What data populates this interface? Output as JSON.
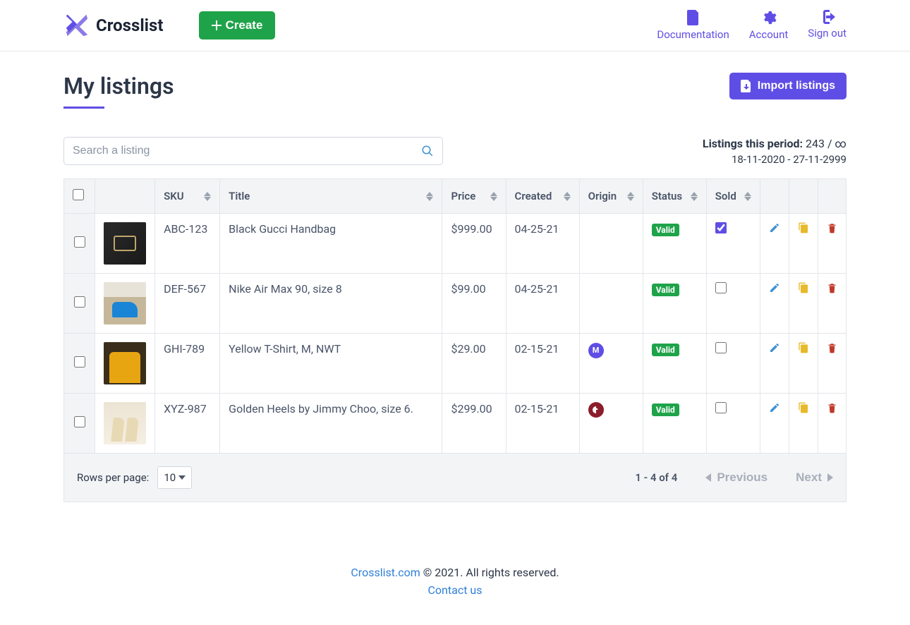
{
  "brand": {
    "name": "Crosslist"
  },
  "topnav": {
    "create_label": "Create",
    "items": [
      {
        "label": "Documentation"
      },
      {
        "label": "Account"
      },
      {
        "label": "Sign out"
      }
    ]
  },
  "page": {
    "title": "My listings",
    "import_label": "Import listings",
    "search_placeholder": "Search a listing",
    "stats_label": "Listings this period:",
    "stats_value": "243 / ∞",
    "stats_period": "18-11-2020 - 27-11-2999"
  },
  "table": {
    "headers": {
      "sku": "SKU",
      "title": "Title",
      "price": "Price",
      "created": "Created",
      "origin": "Origin",
      "status": "Status",
      "sold": "Sold"
    },
    "rows": [
      {
        "sku": "ABC-123",
        "title": "Black Gucci Handbag",
        "price": "$999.00",
        "created": "04-25-21",
        "origin": "",
        "status": "Valid",
        "sold": true,
        "thumb": "bag"
      },
      {
        "sku": "DEF-567",
        "title": "Nike Air Max 90, size 8",
        "price": "$99.00",
        "created": "04-25-21",
        "origin": "",
        "status": "Valid",
        "sold": false,
        "thumb": "shoe"
      },
      {
        "sku": "GHI-789",
        "title": "Yellow T-Shirt, M, NWT",
        "price": "$29.00",
        "created": "02-15-21",
        "origin": "mercari",
        "status": "Valid",
        "sold": false,
        "thumb": "shirt"
      },
      {
        "sku": "XYZ-987",
        "title": "Golden Heels by Jimmy Choo, size 6.",
        "price": "$299.00",
        "created": "02-15-21",
        "origin": "poshmark",
        "status": "Valid",
        "sold": false,
        "thumb": "heels"
      }
    ]
  },
  "pagination": {
    "rows_per_page_label": "Rows per page:",
    "rows_per_page_value": "10",
    "range": "1 - 4 of 4",
    "prev_label": "Previous",
    "next_label": "Next"
  },
  "footer": {
    "site": "Crosslist.com",
    "rights": "© 2021. All rights reserved.",
    "contact": "Contact us"
  }
}
